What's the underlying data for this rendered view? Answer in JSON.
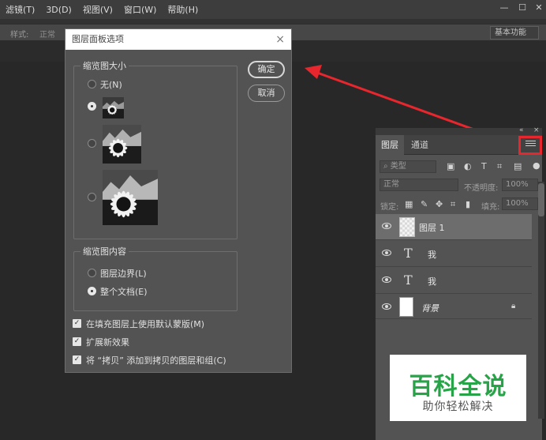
{
  "menubar": {
    "items": [
      "滤镜(T)",
      "3D(D)",
      "视图(V)",
      "窗口(W)",
      "帮助(H)"
    ],
    "window_controls": [
      "—",
      "☐",
      "✕"
    ]
  },
  "options": {
    "style_label": "样式:",
    "style_value": "正常",
    "workspace": "基本功能"
  },
  "dialog": {
    "title": "图层面板选项",
    "size_group": "缩览图大小",
    "size_none": "无(N)",
    "content_group": "缩览图内容",
    "content_bounds": "图层边界(L)",
    "content_document": "整个文档(E)",
    "ok": "确定",
    "cancel": "取消",
    "checkboxes": [
      {
        "label": "在填充图层上使用默认蒙版(M)",
        "checked": true
      },
      {
        "label": "扩展新效果",
        "checked": true
      },
      {
        "label": "将 “拷贝” 添加到拷贝的图层和组(C)",
        "checked": true
      }
    ],
    "selected_size": "small",
    "selected_content": "document"
  },
  "panel": {
    "tabs": [
      "图层",
      "通道"
    ],
    "kind_filter": "类型",
    "blend_mode": "正常",
    "opacity_label": "不透明度:",
    "opacity_value": "100%",
    "lock_label": "锁定:",
    "fill_label": "填充:",
    "fill_value": "100%",
    "layers": [
      {
        "name": "图层 1",
        "kind": "pixel",
        "selected": true
      },
      {
        "name": "我",
        "kind": "text",
        "selected": false
      },
      {
        "name": "我",
        "kind": "text",
        "selected": false
      },
      {
        "name": "背景",
        "kind": "background",
        "selected": false,
        "locked": true
      }
    ]
  },
  "watermark": {
    "main": "百科全说",
    "sub": "助你轻松解决"
  },
  "colors": {
    "annotation_red": "#e8262d",
    "watermark_green": "#27a348"
  }
}
